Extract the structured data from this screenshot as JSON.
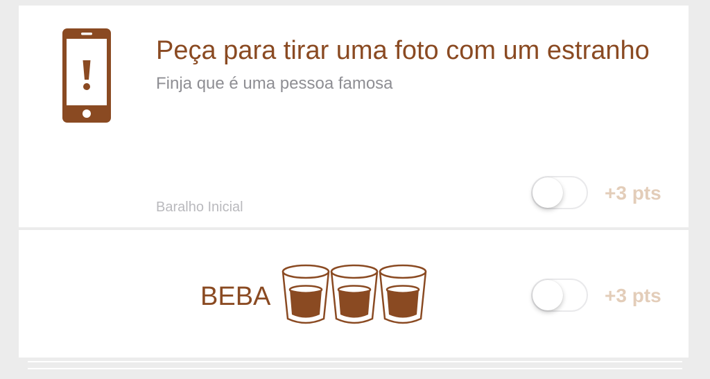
{
  "challenge": {
    "title": "Peça para tirar uma foto com um estranho",
    "subtitle": "Finja que é uma pessoa famosa",
    "deck": "Baralho Inicial",
    "icon": "phone-alert-icon",
    "toggle_on": false,
    "points": "+3 pts"
  },
  "drink": {
    "label": "BEBA",
    "icon": "shot-glass-icon",
    "shots": 3,
    "toggle_on": false,
    "points": "+3 pts"
  },
  "colors": {
    "accent": "#8a4a22",
    "points_text": "#e3cdb9",
    "subtitle": "#8e8e93",
    "deck_label": "#b9b9bd",
    "background": "#ececec"
  }
}
